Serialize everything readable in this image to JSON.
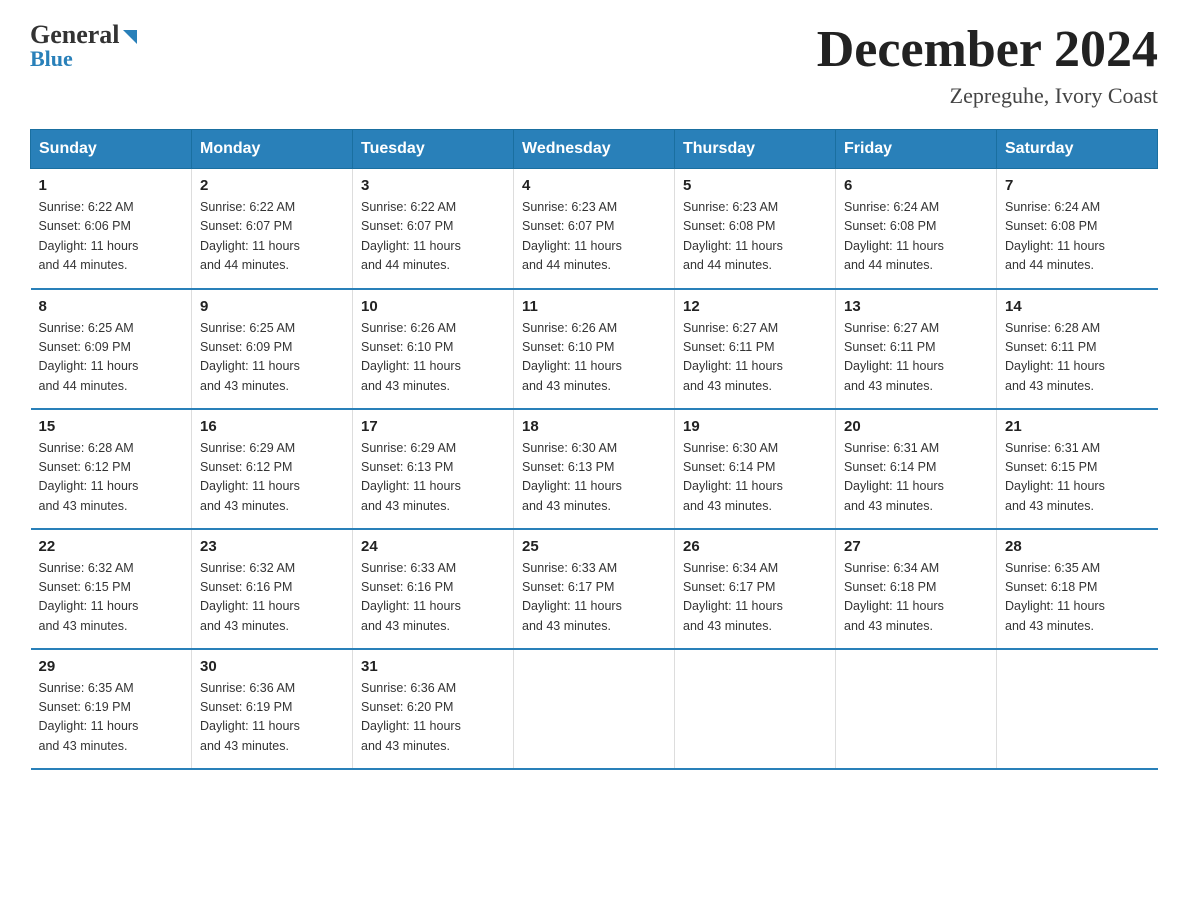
{
  "logo": {
    "general": "General",
    "blue": "Blue"
  },
  "header": {
    "month": "December 2024",
    "location": "Zepreguhe, Ivory Coast"
  },
  "weekdays": [
    "Sunday",
    "Monday",
    "Tuesday",
    "Wednesday",
    "Thursday",
    "Friday",
    "Saturday"
  ],
  "weeks": [
    [
      {
        "day": "1",
        "sunrise": "6:22 AM",
        "sunset": "6:06 PM",
        "daylight": "11 hours and 44 minutes."
      },
      {
        "day": "2",
        "sunrise": "6:22 AM",
        "sunset": "6:07 PM",
        "daylight": "11 hours and 44 minutes."
      },
      {
        "day": "3",
        "sunrise": "6:22 AM",
        "sunset": "6:07 PM",
        "daylight": "11 hours and 44 minutes."
      },
      {
        "day": "4",
        "sunrise": "6:23 AM",
        "sunset": "6:07 PM",
        "daylight": "11 hours and 44 minutes."
      },
      {
        "day": "5",
        "sunrise": "6:23 AM",
        "sunset": "6:08 PM",
        "daylight": "11 hours and 44 minutes."
      },
      {
        "day": "6",
        "sunrise": "6:24 AM",
        "sunset": "6:08 PM",
        "daylight": "11 hours and 44 minutes."
      },
      {
        "day": "7",
        "sunrise": "6:24 AM",
        "sunset": "6:08 PM",
        "daylight": "11 hours and 44 minutes."
      }
    ],
    [
      {
        "day": "8",
        "sunrise": "6:25 AM",
        "sunset": "6:09 PM",
        "daylight": "11 hours and 44 minutes."
      },
      {
        "day": "9",
        "sunrise": "6:25 AM",
        "sunset": "6:09 PM",
        "daylight": "11 hours and 43 minutes."
      },
      {
        "day": "10",
        "sunrise": "6:26 AM",
        "sunset": "6:10 PM",
        "daylight": "11 hours and 43 minutes."
      },
      {
        "day": "11",
        "sunrise": "6:26 AM",
        "sunset": "6:10 PM",
        "daylight": "11 hours and 43 minutes."
      },
      {
        "day": "12",
        "sunrise": "6:27 AM",
        "sunset": "6:11 PM",
        "daylight": "11 hours and 43 minutes."
      },
      {
        "day": "13",
        "sunrise": "6:27 AM",
        "sunset": "6:11 PM",
        "daylight": "11 hours and 43 minutes."
      },
      {
        "day": "14",
        "sunrise": "6:28 AM",
        "sunset": "6:11 PM",
        "daylight": "11 hours and 43 minutes."
      }
    ],
    [
      {
        "day": "15",
        "sunrise": "6:28 AM",
        "sunset": "6:12 PM",
        "daylight": "11 hours and 43 minutes."
      },
      {
        "day": "16",
        "sunrise": "6:29 AM",
        "sunset": "6:12 PM",
        "daylight": "11 hours and 43 minutes."
      },
      {
        "day": "17",
        "sunrise": "6:29 AM",
        "sunset": "6:13 PM",
        "daylight": "11 hours and 43 minutes."
      },
      {
        "day": "18",
        "sunrise": "6:30 AM",
        "sunset": "6:13 PM",
        "daylight": "11 hours and 43 minutes."
      },
      {
        "day": "19",
        "sunrise": "6:30 AM",
        "sunset": "6:14 PM",
        "daylight": "11 hours and 43 minutes."
      },
      {
        "day": "20",
        "sunrise": "6:31 AM",
        "sunset": "6:14 PM",
        "daylight": "11 hours and 43 minutes."
      },
      {
        "day": "21",
        "sunrise": "6:31 AM",
        "sunset": "6:15 PM",
        "daylight": "11 hours and 43 minutes."
      }
    ],
    [
      {
        "day": "22",
        "sunrise": "6:32 AM",
        "sunset": "6:15 PM",
        "daylight": "11 hours and 43 minutes."
      },
      {
        "day": "23",
        "sunrise": "6:32 AM",
        "sunset": "6:16 PM",
        "daylight": "11 hours and 43 minutes."
      },
      {
        "day": "24",
        "sunrise": "6:33 AM",
        "sunset": "6:16 PM",
        "daylight": "11 hours and 43 minutes."
      },
      {
        "day": "25",
        "sunrise": "6:33 AM",
        "sunset": "6:17 PM",
        "daylight": "11 hours and 43 minutes."
      },
      {
        "day": "26",
        "sunrise": "6:34 AM",
        "sunset": "6:17 PM",
        "daylight": "11 hours and 43 minutes."
      },
      {
        "day": "27",
        "sunrise": "6:34 AM",
        "sunset": "6:18 PM",
        "daylight": "11 hours and 43 minutes."
      },
      {
        "day": "28",
        "sunrise": "6:35 AM",
        "sunset": "6:18 PM",
        "daylight": "11 hours and 43 minutes."
      }
    ],
    [
      {
        "day": "29",
        "sunrise": "6:35 AM",
        "sunset": "6:19 PM",
        "daylight": "11 hours and 43 minutes."
      },
      {
        "day": "30",
        "sunrise": "6:36 AM",
        "sunset": "6:19 PM",
        "daylight": "11 hours and 43 minutes."
      },
      {
        "day": "31",
        "sunrise": "6:36 AM",
        "sunset": "6:20 PM",
        "daylight": "11 hours and 43 minutes."
      },
      null,
      null,
      null,
      null
    ]
  ],
  "labels": {
    "sunrise": "Sunrise:",
    "sunset": "Sunset:",
    "daylight": "Daylight:"
  }
}
